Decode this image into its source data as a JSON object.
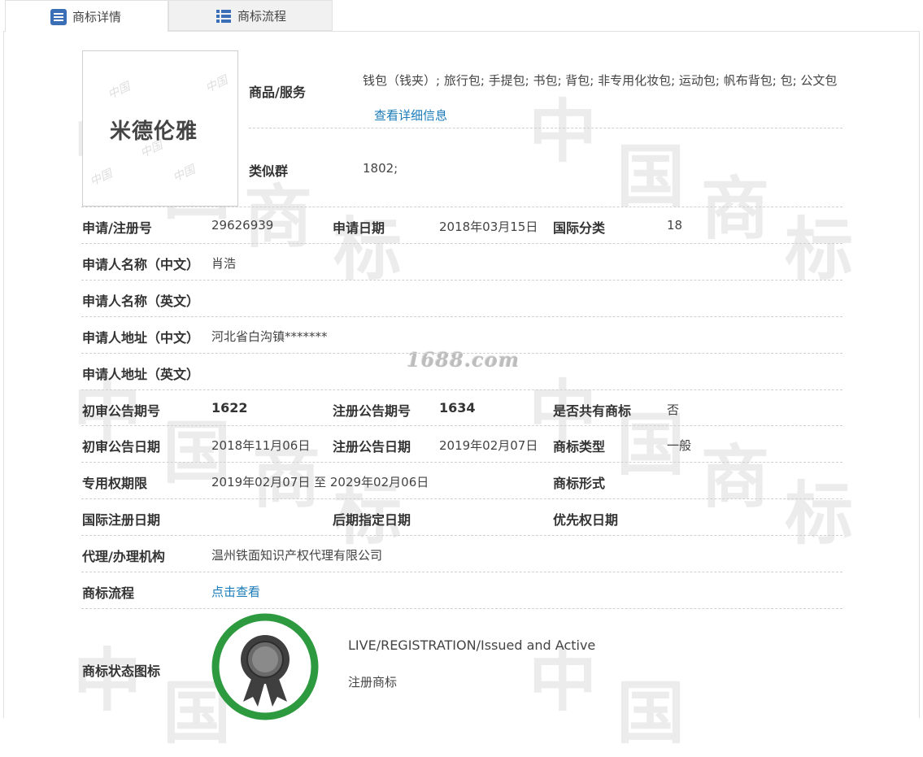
{
  "tabs": [
    {
      "label": "商标详情",
      "icon": "document-list-icon",
      "active": true
    },
    {
      "label": "商标流程",
      "icon": "list-grid-icon",
      "active": false
    }
  ],
  "watermark": {
    "site": "1688.com"
  },
  "logo": {
    "text": "米德伦雅",
    "watermark_text": "中国"
  },
  "goods": {
    "label": "商品/服务",
    "value": "钱包（钱夹）; 旅行包; 手提包; 书包; 背包; 非专用化妆包; 运动包; 帆布背包; 包; 公文包",
    "detail_link": "查看详细信息"
  },
  "similar_group": {
    "label": "类似群",
    "value": "1802;"
  },
  "fields": {
    "reg_no_label": "申请/注册号",
    "reg_no": "29626939",
    "apply_date_label": "申请日期",
    "apply_date": "2018年03月15日",
    "intl_class_label": "国际分类",
    "intl_class": "18",
    "applicant_cn_label": "申请人名称（中文）",
    "applicant_cn": "肖浩",
    "applicant_en_label": "申请人名称（英文）",
    "applicant_en": "",
    "address_cn_label": "申请人地址（中文）",
    "address_cn": "河北省白沟镇*******",
    "address_en_label": "申请人地址（英文）",
    "address_en": "",
    "prelim_issue_label": "初审公告期号",
    "prelim_issue": "1622",
    "reg_issue_label": "注册公告期号",
    "reg_issue": "1634",
    "shared_label": "是否共有商标",
    "shared": "否",
    "prelim_date_label": "初审公告日期",
    "prelim_date": "2018年11月06日",
    "reg_date_label": "注册公告日期",
    "reg_date": "2019年02月07日",
    "tm_type_label": "商标类型",
    "tm_type": "一般",
    "exclusive_label": "专用权期限",
    "exclusive": "2019年02月07日 至 2029年02月06日",
    "tm_form_label": "商标形式",
    "tm_form": "",
    "intl_reg_date_label": "国际注册日期",
    "intl_reg_date": "",
    "later_date_label": "后期指定日期",
    "later_date": "",
    "priority_label": "优先权日期",
    "priority": "",
    "agent_label": "代理/办理机构",
    "agent": "温州铁面知识产权代理有限公司",
    "process_label": "商标流程",
    "process_link": "点击查看",
    "status_icon_label": "商标状态图标",
    "status_en": "LIVE/REGISTRATION/Issued and Active",
    "status_cn": "注册商标"
  },
  "colors": {
    "link": "#1a7bb9",
    "badge_ring": "#2e9a40",
    "badge_medal": "#3f3f3f"
  }
}
